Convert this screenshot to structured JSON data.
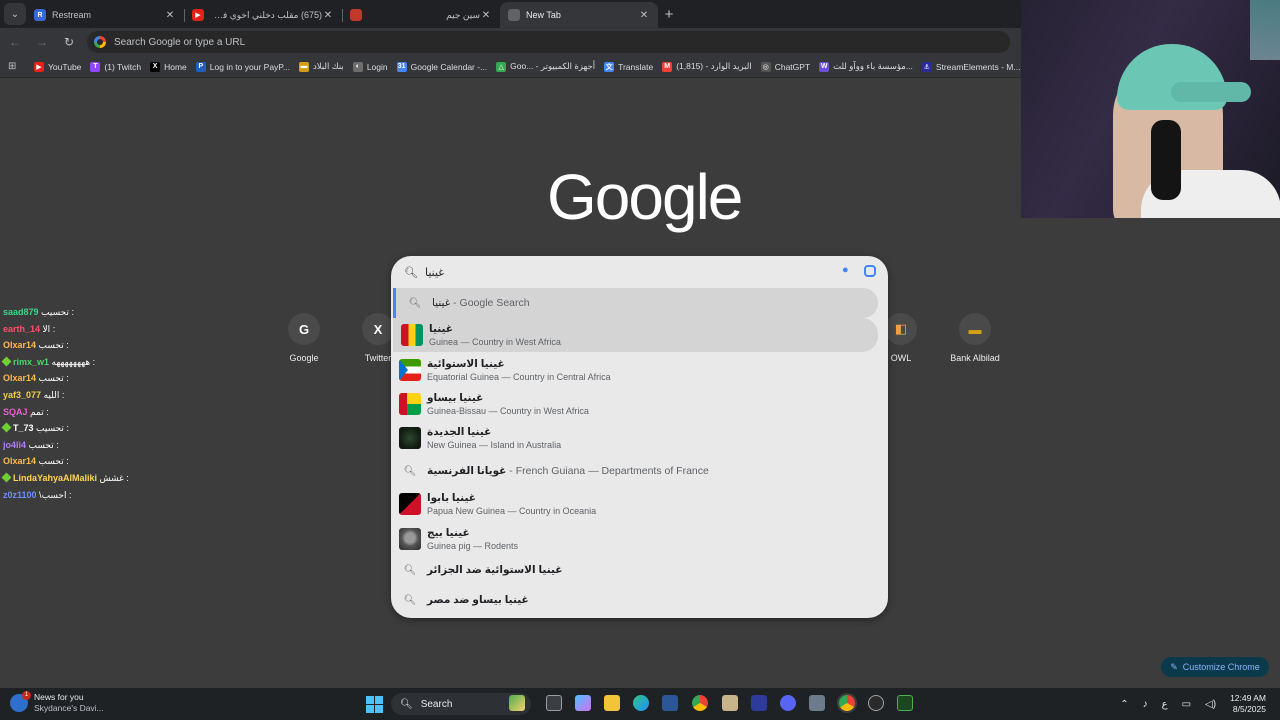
{
  "tabs": [
    {
      "title": "Restream",
      "rtl": false,
      "fav_color": "#3867d6",
      "fav_letter": "R",
      "closable": true
    },
    {
      "title": "(675) مقلب دخلني اخوي في بالر...",
      "rtl": true,
      "fav_color": "#e62117",
      "fav_letter": "▶",
      "closable": true
    },
    {
      "title": "سين جيم",
      "rtl": true,
      "fav_color": "#c0392b",
      "fav_letter": "",
      "closable": true
    },
    {
      "title": "New Tab",
      "rtl": false,
      "fav_color": "#5f6368",
      "fav_letter": "",
      "closable": true,
      "active": true
    }
  ],
  "omnibox": {
    "placeholder": "Search Google or type a URL"
  },
  "bookmarks": [
    {
      "label": "YouTube",
      "color": "#e62117",
      "glyph": "▶"
    },
    {
      "label": "(1) Twitch",
      "color": "#9146ff",
      "glyph": "T"
    },
    {
      "label": "Home",
      "color": "#000000",
      "glyph": "X"
    },
    {
      "label": "Log in to your PayP...",
      "color": "#1f5fbf",
      "glyph": "P"
    },
    {
      "label": "بنك البلاد",
      "color": "#d4a017",
      "glyph": "▬"
    },
    {
      "label": "Login",
      "color": "#6d6d6d",
      "glyph": "◐"
    },
    {
      "label": "Google Calendar -...",
      "color": "#4285f4",
      "glyph": "31"
    },
    {
      "label": "Goo... - أجهزة الكمبيوتر",
      "color": "#34a853",
      "glyph": "△"
    },
    {
      "label": "Translate",
      "color": "#4285f4",
      "glyph": "文"
    },
    {
      "label": "(1,815) - البريد الوارد",
      "color": "#ea4335",
      "glyph": "M"
    },
    {
      "label": "ChatGPT",
      "color": "#555555",
      "glyph": "◎"
    },
    {
      "label": "مؤسسة باء ووآو للت...",
      "color": "#6b4fd8",
      "glyph": "W"
    },
    {
      "label": "StreamElements - M...",
      "color": "#2c2a9c",
      "glyph": "⚓"
    }
  ],
  "google_logo": "Google",
  "shortcuts": [
    {
      "label": "Google",
      "glyph": "G",
      "color": "#4285f4"
    },
    {
      "label": "Twitter",
      "glyph": "X",
      "color": "#000000"
    },
    {
      "label": "OWL",
      "glyph": "◧",
      "color": "#f0a040"
    },
    {
      "label": "Bank Albilad",
      "glyph": "▬",
      "color": "#d4a017"
    }
  ],
  "search": {
    "query": "غينيا",
    "suggestions": [
      {
        "kind": "search",
        "main": "غينيا",
        "suffix": " - Google Search",
        "highlight": true,
        "selected": true
      },
      {
        "kind": "entity",
        "main": "غينيا",
        "sub": "Guinea — Country in West Africa",
        "thumb": "flag-guinea",
        "highlight": true
      },
      {
        "kind": "entity",
        "main": "غينيا الاستوائية",
        "sub": "Equatorial Guinea — Country in Central Africa",
        "thumb": "flag-eqg"
      },
      {
        "kind": "entity",
        "main": "غينيا بيساو",
        "sub": "Guinea-Bissau — Country in West Africa",
        "thumb": "flag-gb"
      },
      {
        "kind": "entity",
        "main": "غينيا الجديدة",
        "sub": "New Guinea — Island in Australia",
        "thumb": "thumb-ng"
      },
      {
        "kind": "search",
        "main": "غويانا الفرنسية",
        "suffix": " - French Guiana — Departments of France"
      },
      {
        "kind": "entity",
        "main": "غينيا بابوا",
        "sub": "Papua New Guinea — Country in Oceania",
        "thumb": "flag-png"
      },
      {
        "kind": "entity",
        "main": "غينيا بيج",
        "sub": "Guinea pig — Rodents",
        "thumb": "thumb-pig"
      },
      {
        "kind": "search",
        "main": "غينيا الاستوائية ضد الجزائر"
      },
      {
        "kind": "search",
        "main": "غينيا بيساو ضد مصر"
      }
    ]
  },
  "chat": [
    {
      "user": "saad879",
      "color": "#39d98a",
      "msg": "تحسيب :",
      "badge": false
    },
    {
      "user": "earth_14",
      "color": "#ff4f6a",
      "msg": "الا :",
      "badge": false
    },
    {
      "user": "Olxar14",
      "color": "#ffb84d",
      "msg": "تحسب :",
      "badge": false
    },
    {
      "user": "rimx_w1",
      "color": "#48d96a",
      "msg": "ههههههههه :",
      "badge": true
    },
    {
      "user": "Olxar14",
      "color": "#ffb84d",
      "msg": "تحسب :",
      "badge": false
    },
    {
      "user": "yaf3_077",
      "color": "#f3d046",
      "msg": "الليه :",
      "badge": false
    },
    {
      "user": "SQAJ",
      "color": "#e85fd1",
      "msg": "تمم :",
      "badge": false
    },
    {
      "user": "T_73",
      "color": "#ffffff",
      "msg": "تحسيب :",
      "badge": true
    },
    {
      "user": "jo4li4",
      "color": "#b07cff",
      "msg": "تحسب :",
      "badge": false
    },
    {
      "user": "Olxar14",
      "color": "#ffb84d",
      "msg": "تحسب :",
      "badge": false
    },
    {
      "user": "LindaYahyaAlMaliki",
      "color": "#ffd54f",
      "msg": "غشش :",
      "badge": true
    },
    {
      "user": "z0z1100",
      "color": "#6f8cff",
      "msg": "\\احسب :",
      "badge": false
    }
  ],
  "customize_label": "Customize Chrome",
  "taskbar": {
    "news_title": "News for you",
    "news_sub": "Skydance's Davi...",
    "news_badge": "1",
    "search_label": "Search",
    "time": "12:49 AM",
    "date": "8/5/2025",
    "lang": "ع"
  }
}
